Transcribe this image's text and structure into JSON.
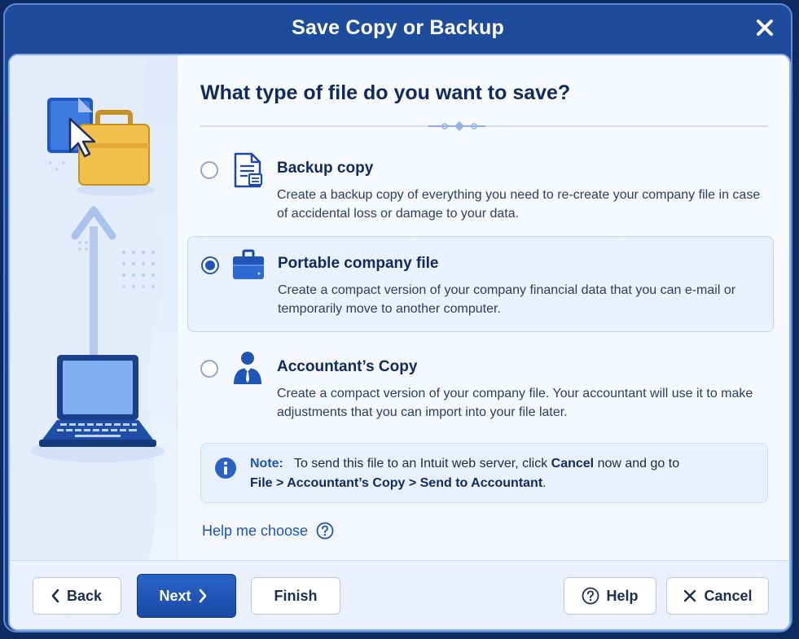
{
  "window": {
    "title": "Save Copy or Backup"
  },
  "heading": "What type of file do you want to save?",
  "options": [
    {
      "title": "Backup copy",
      "description": "Create a backup copy of everything you need to re-create your company file in case of accidental loss or damage to your data.",
      "icon": "document-icon",
      "selected": false
    },
    {
      "title": "Portable company file",
      "description": "Create a compact version of your company financial data that you can e-mail or temporarily move to another computer.",
      "icon": "briefcase-icon",
      "selected": true
    },
    {
      "title": "Accountant’s Copy",
      "description": "Create a compact version of your company file. Your accountant will use it to make adjustments that you can import into your file later.",
      "icon": "accountant-icon",
      "selected": false
    }
  ],
  "note": {
    "label": "Note:",
    "text_1": "To send this file to an Intuit web server, click",
    "cancel_word": "Cancel",
    "text_2": "now and go to",
    "path": "File > Accountant’s Copy > Send to Accountant",
    "period": "."
  },
  "help_link": "Help me choose",
  "buttons": {
    "back": "Back",
    "next": "Next",
    "finish": "Finish",
    "help": "Help",
    "cancel": "Cancel"
  },
  "colors": {
    "title_bar": "#1d4d9c",
    "accent": "#1d55b8",
    "heading": "#10295e",
    "selected_bg": "#e9f1fc"
  }
}
